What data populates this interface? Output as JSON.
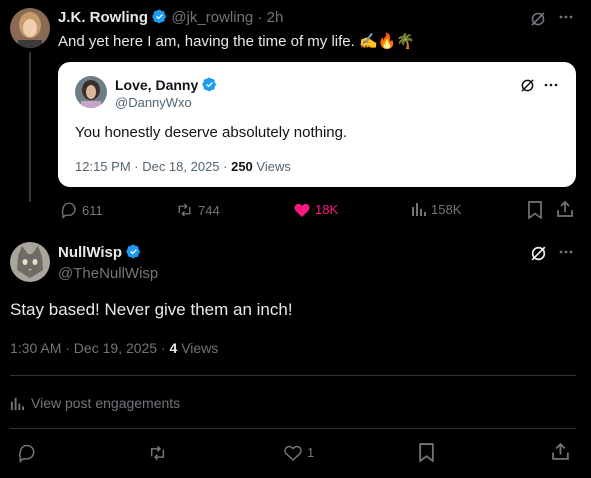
{
  "top_tweet": {
    "display_name": "J.K. Rowling",
    "handle": "@jk_rowling",
    "time": "· 2h",
    "text": "And yet here I am, having the time of my life. ",
    "emoji": "✍️🔥🌴",
    "quote": {
      "display_name": "Love, Danny",
      "handle": "@DannyWxo",
      "text": "You honestly deserve absolutely nothing.",
      "timestamp": "12:15 PM · Dec 18, 2025 · ",
      "views_count": "250",
      "views_label": " Views"
    },
    "actions": {
      "replies": "611",
      "reposts": "744",
      "likes": "18K",
      "views": "158K"
    }
  },
  "main_tweet": {
    "display_name": "NullWisp",
    "handle": "@TheNullWisp",
    "text": "Stay based! Never give them an inch!",
    "timestamp": "1:30 AM · Dec 19, 2025 · ",
    "views_count": "4",
    "views_label": " Views",
    "engagements_label": "View post engagements",
    "actions": {
      "likes": "1"
    }
  },
  "colors": {
    "background": "#000000",
    "like_active": "#f91880",
    "verified": "#1d9bf0",
    "muted": "#71767b"
  }
}
